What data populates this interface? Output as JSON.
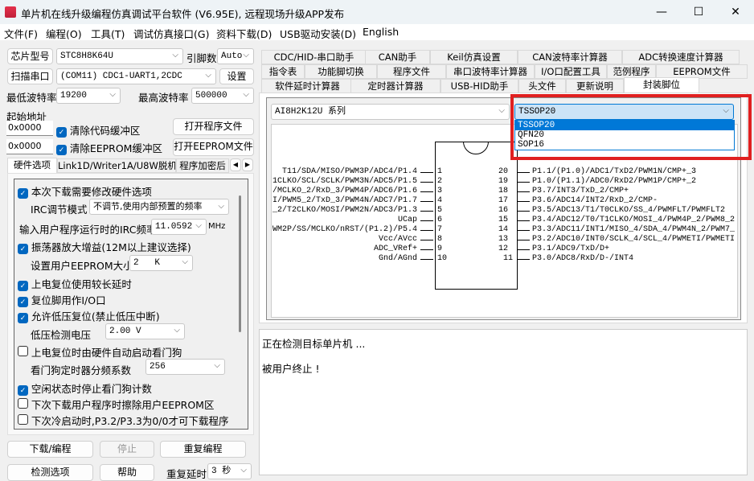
{
  "window": {
    "title": "单片机在线升级编程仿真调试平台软件 (V6.95E), 远程现场升级APP发布",
    "min": "—",
    "max": "☐",
    "close": "✕"
  },
  "menu": [
    "文件(F)",
    "编程(O)",
    "工具(T)",
    "调试仿真接口(G)",
    "资料下载(D)",
    "USB驱动安装(D)",
    "English"
  ],
  "left": {
    "chip_btn": "芯片型号",
    "chip_value": "STC8H8K64U",
    "pins_label": "引脚数",
    "pins_value": "Auto",
    "scan_btn": "扫描串口",
    "port_value": "(COM11) CDC1-UART1,2CDC",
    "settings_btn": "设置",
    "min_baud_label": "最低波特率",
    "min_baud": "19200",
    "max_baud_label": "最高波特率",
    "max_baud": "500000",
    "start_addr_label": "起始地址",
    "addr1": "0x0000",
    "addr2": "0x0000",
    "clear_code": "清除代码缓冲区",
    "clear_eeprom": "清除EEPROM缓冲区",
    "open_prog": "打开程序文件",
    "open_eeprom": "打开EEPROM文件",
    "tabs": [
      "硬件选项",
      "Link1D/Writer1A/U8W脱机",
      "程序加密后"
    ],
    "opts": {
      "modify_hw": "本次下载需要修改硬件选项",
      "irc_mode_label": "IRC调节模式",
      "irc_mode": "不调节,使用内部预置的频率",
      "irc_freq_label": "输入用户程序运行时的IRC频率",
      "irc_freq": "11.0592",
      "mhz": "MHz",
      "osc_gain": "振荡器放大增益(12M以上建议选择)",
      "eeprom_size_label": "设置用户EEPROM大小",
      "eeprom_size": "2   K",
      "long_delay": "上电复位使用较长延时",
      "reset_io": "复位脚用作I/O口",
      "lvr": "允许低压复位(禁止低压中断)",
      "lvd_label": "低压检测电压",
      "lvd": "2.00 V",
      "wdt_auto": "上电复位时由硬件自动启动看门狗",
      "wdt_div_label": "看门狗定时器分频系数",
      "wdt_div": "256",
      "wdt_idle": "空闲状态时停止看门狗计数",
      "erase_eeprom": "下次下载用户程序时擦除用户EEPROM区",
      "cold_boot": "下次冷启动时,P3.2/P3.3为0/0才可下载程序"
    },
    "download": "下载/编程",
    "stop": "停止",
    "repeat": "重复编程",
    "detect": "检测选项",
    "help": "帮助",
    "repeat_delay_label": "重复延时",
    "repeat_delay": "3 秒"
  },
  "right": {
    "tabs_row1": [
      "CDC/HID-串口助手",
      "CAN助手",
      "Keil仿真设置",
      "CAN波特率计算器",
      "ADC转换速度计算器"
    ],
    "tabs_row2": [
      "指令表",
      "功能脚切换",
      "程序文件",
      "串口波特率计算器",
      "I/O口配置工具",
      "范例程序",
      "EEPROM文件"
    ],
    "tabs_row3": [
      "软件延时计算器",
      "定时器计算器",
      "USB-HID助手",
      "头文件",
      "更新说明",
      "封装脚位"
    ],
    "series": "AI8H2K12U 系列",
    "package": "TSSOP20",
    "package_options": [
      "TSSOP20",
      "QFN20",
      "SOP16"
    ],
    "left_pins": [
      {
        "n": "1",
        "t": "T11/SDA/MISO/PWM3P/ADC4/P1.4"
      },
      {
        "n": "2",
        "t": "1CLKO/SCL/SCLK/PWM3N/ADC5/P1.5"
      },
      {
        "n": "3",
        "t": "/MCLKO_2/RxD_3/PWM4P/ADC6/P1.6"
      },
      {
        "n": "4",
        "t": "I/PWM5_2/TxD_3/PWM4N/ADC7/P1.7"
      },
      {
        "n": "5",
        "t": "_2/T2CLKO/MOSI/PWM2N/ADC3/P1.3"
      },
      {
        "n": "6",
        "t": "UCap"
      },
      {
        "n": "7",
        "t": "WM2P/SS/MCLKO/nRST/(P1.2)/P5.4"
      },
      {
        "n": "8",
        "t": "Vcc/AVcc"
      },
      {
        "n": "9",
        "t": "ADC_VRef+"
      },
      {
        "n": "10",
        "t": "Gnd/AGnd"
      }
    ],
    "right_pins": [
      {
        "n": "20",
        "t": "P1.1/(P1.0)/ADC1/TxD2/PWM1N/CMP+_3"
      },
      {
        "n": "19",
        "t": "P1.0/(P1.1)/ADC0/RxD2/PWM1P/CMP+_2"
      },
      {
        "n": "18",
        "t": "P3.7/INT3/TxD_2/CMP+"
      },
      {
        "n": "17",
        "t": "P3.6/ADC14/INT2/RxD_2/CMP-"
      },
      {
        "n": "16",
        "t": "P3.5/ADC13/T1/T0CLKO/SS_4/PWMFLT/PWMFLT2"
      },
      {
        "n": "15",
        "t": "P3.4/ADC12/T0/T1CLKO/MOSI_4/PWM4P_2/PWM8_2"
      },
      {
        "n": "14",
        "t": "P3.3/ADC11/INT1/MISO_4/SDA_4/PWM4N_2/PWM7_"
      },
      {
        "n": "13",
        "t": "P3.2/ADC10/INT0/SCLK_4/SCL_4/PWMETI/PWMETI"
      },
      {
        "n": "12",
        "t": "P3.1/ADC9/TxD/D+"
      },
      {
        "n": "11",
        "t": "P3.0/ADC8/RxD/D-/INT4"
      }
    ],
    "log": [
      "正在检测目标单片机 ...",
      "被用户终止 !"
    ]
  }
}
